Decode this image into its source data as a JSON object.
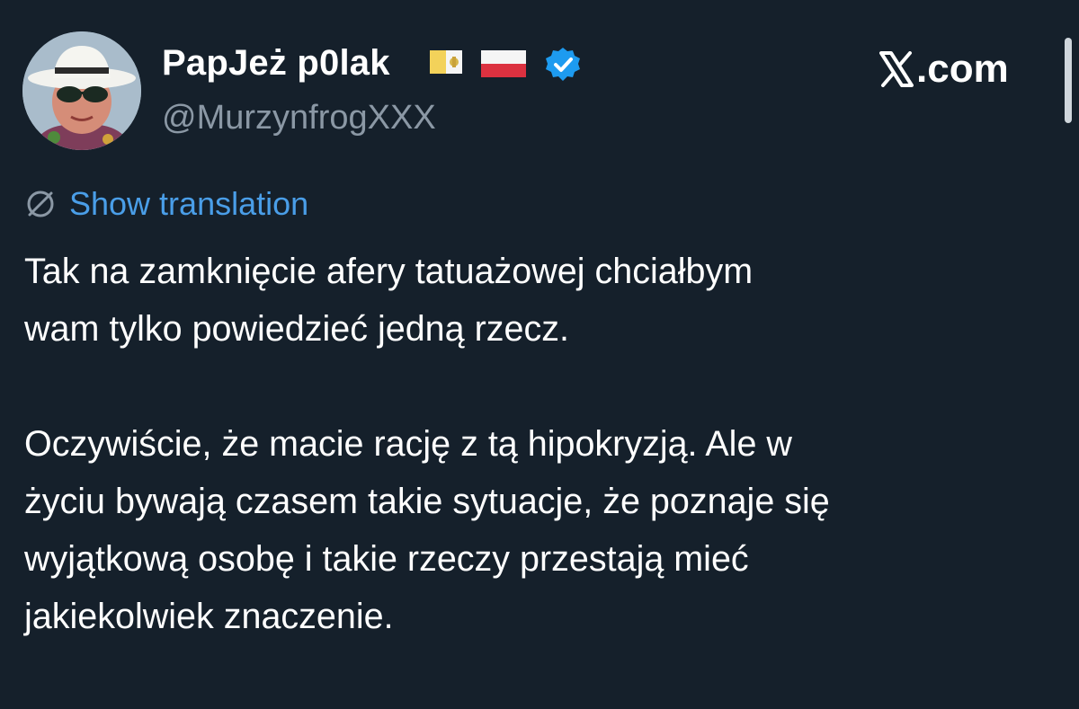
{
  "author": {
    "display_name": "PapJeż p0lak",
    "handle": "@MurzynfrogXXX",
    "avatar": "avatar-photo",
    "flags": [
      "vatican-flag-icon",
      "poland-flag-icon"
    ],
    "verified_icon": "verified-badge-icon"
  },
  "watermark": {
    "logo_icon": "x-logo-icon",
    "text": ".com"
  },
  "translation": {
    "icon": "globe-icon",
    "label": "Show translation"
  },
  "tweet": {
    "text": "Tak na zamknięcie afery tatuażowej chciałbym\nwam tylko powiedzieć jedną rzecz.\n\nOczywiście, że macie rację z tą hipokryzją. Ale w\nżyciu bywają czasem takie sytuacje, że poznaje się\nwyjątkową osobę i takie rzeczy przestają mieć\njakiekolwiek znaczenie."
  },
  "colors": {
    "background": "#15202b",
    "text": "#ffffff",
    "secondary_text": "#8b98a5",
    "link": "#4a9ee8",
    "verified": "#1d9bf0"
  }
}
